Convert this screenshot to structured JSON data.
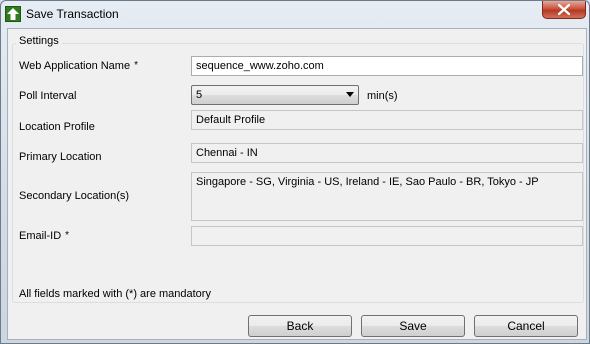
{
  "window": {
    "title": "Save Transaction"
  },
  "settings": {
    "group_label": "Settings",
    "web_app_name": {
      "label": "Web Application Name",
      "required_mark": "*",
      "value": "sequence_www.zoho.com"
    },
    "poll_interval": {
      "label": "Poll Interval",
      "value": "5",
      "unit": "min(s)"
    },
    "location_profile": {
      "label": "Location Profile",
      "value": "Default Profile"
    },
    "primary_location": {
      "label": "Primary Location",
      "value": "Chennai - IN"
    },
    "secondary_locations": {
      "label": "Secondary Location(s)",
      "value": "Singapore - SG, Virginia - US, Ireland - IE, Sao Paulo - BR, Tokyo - JP"
    },
    "email_id": {
      "label": "Email-ID",
      "required_mark": "*",
      "value": ""
    },
    "mandatory_note": "All fields marked with (*) are mandatory"
  },
  "buttons": {
    "back": "Back",
    "save": "Save",
    "cancel": "Cancel"
  },
  "icons": {
    "app": "green-up-arrow-icon",
    "close": "close-icon"
  }
}
